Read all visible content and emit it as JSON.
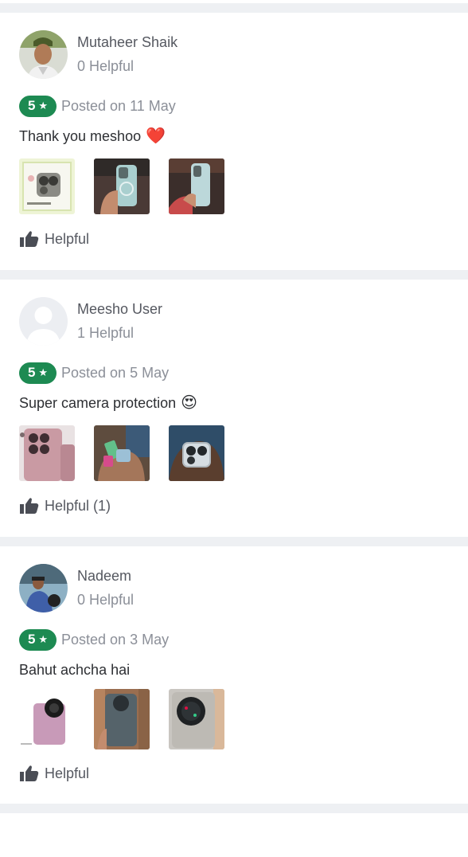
{
  "reviews": [
    {
      "name": "Mutaheer Shaik",
      "helpful_count": "0 Helpful",
      "rating": "5",
      "posted": "Posted on 11 May",
      "text": "Thank you meshoo",
      "emoji": "❤️",
      "helpful_label": "Helpful"
    },
    {
      "name": "Meesho User",
      "helpful_count": "1 Helpful",
      "rating": "5",
      "posted": "Posted on 5 May",
      "text": "Super camera protection",
      "emoji": "😍",
      "helpful_label": "Helpful (1)"
    },
    {
      "name": "Nadeem",
      "helpful_count": "0 Helpful",
      "rating": "5",
      "posted": "Posted on 3 May",
      "text": "Bahut achcha hai",
      "emoji": "",
      "helpful_label": "Helpful"
    }
  ],
  "colors": {
    "rating_badge": "#1d8a52",
    "separator": "#eef0f3",
    "muted_text": "#8b8f98"
  },
  "icons": {
    "rating_star": "star-icon",
    "helpful": "thumbs-up-icon"
  }
}
